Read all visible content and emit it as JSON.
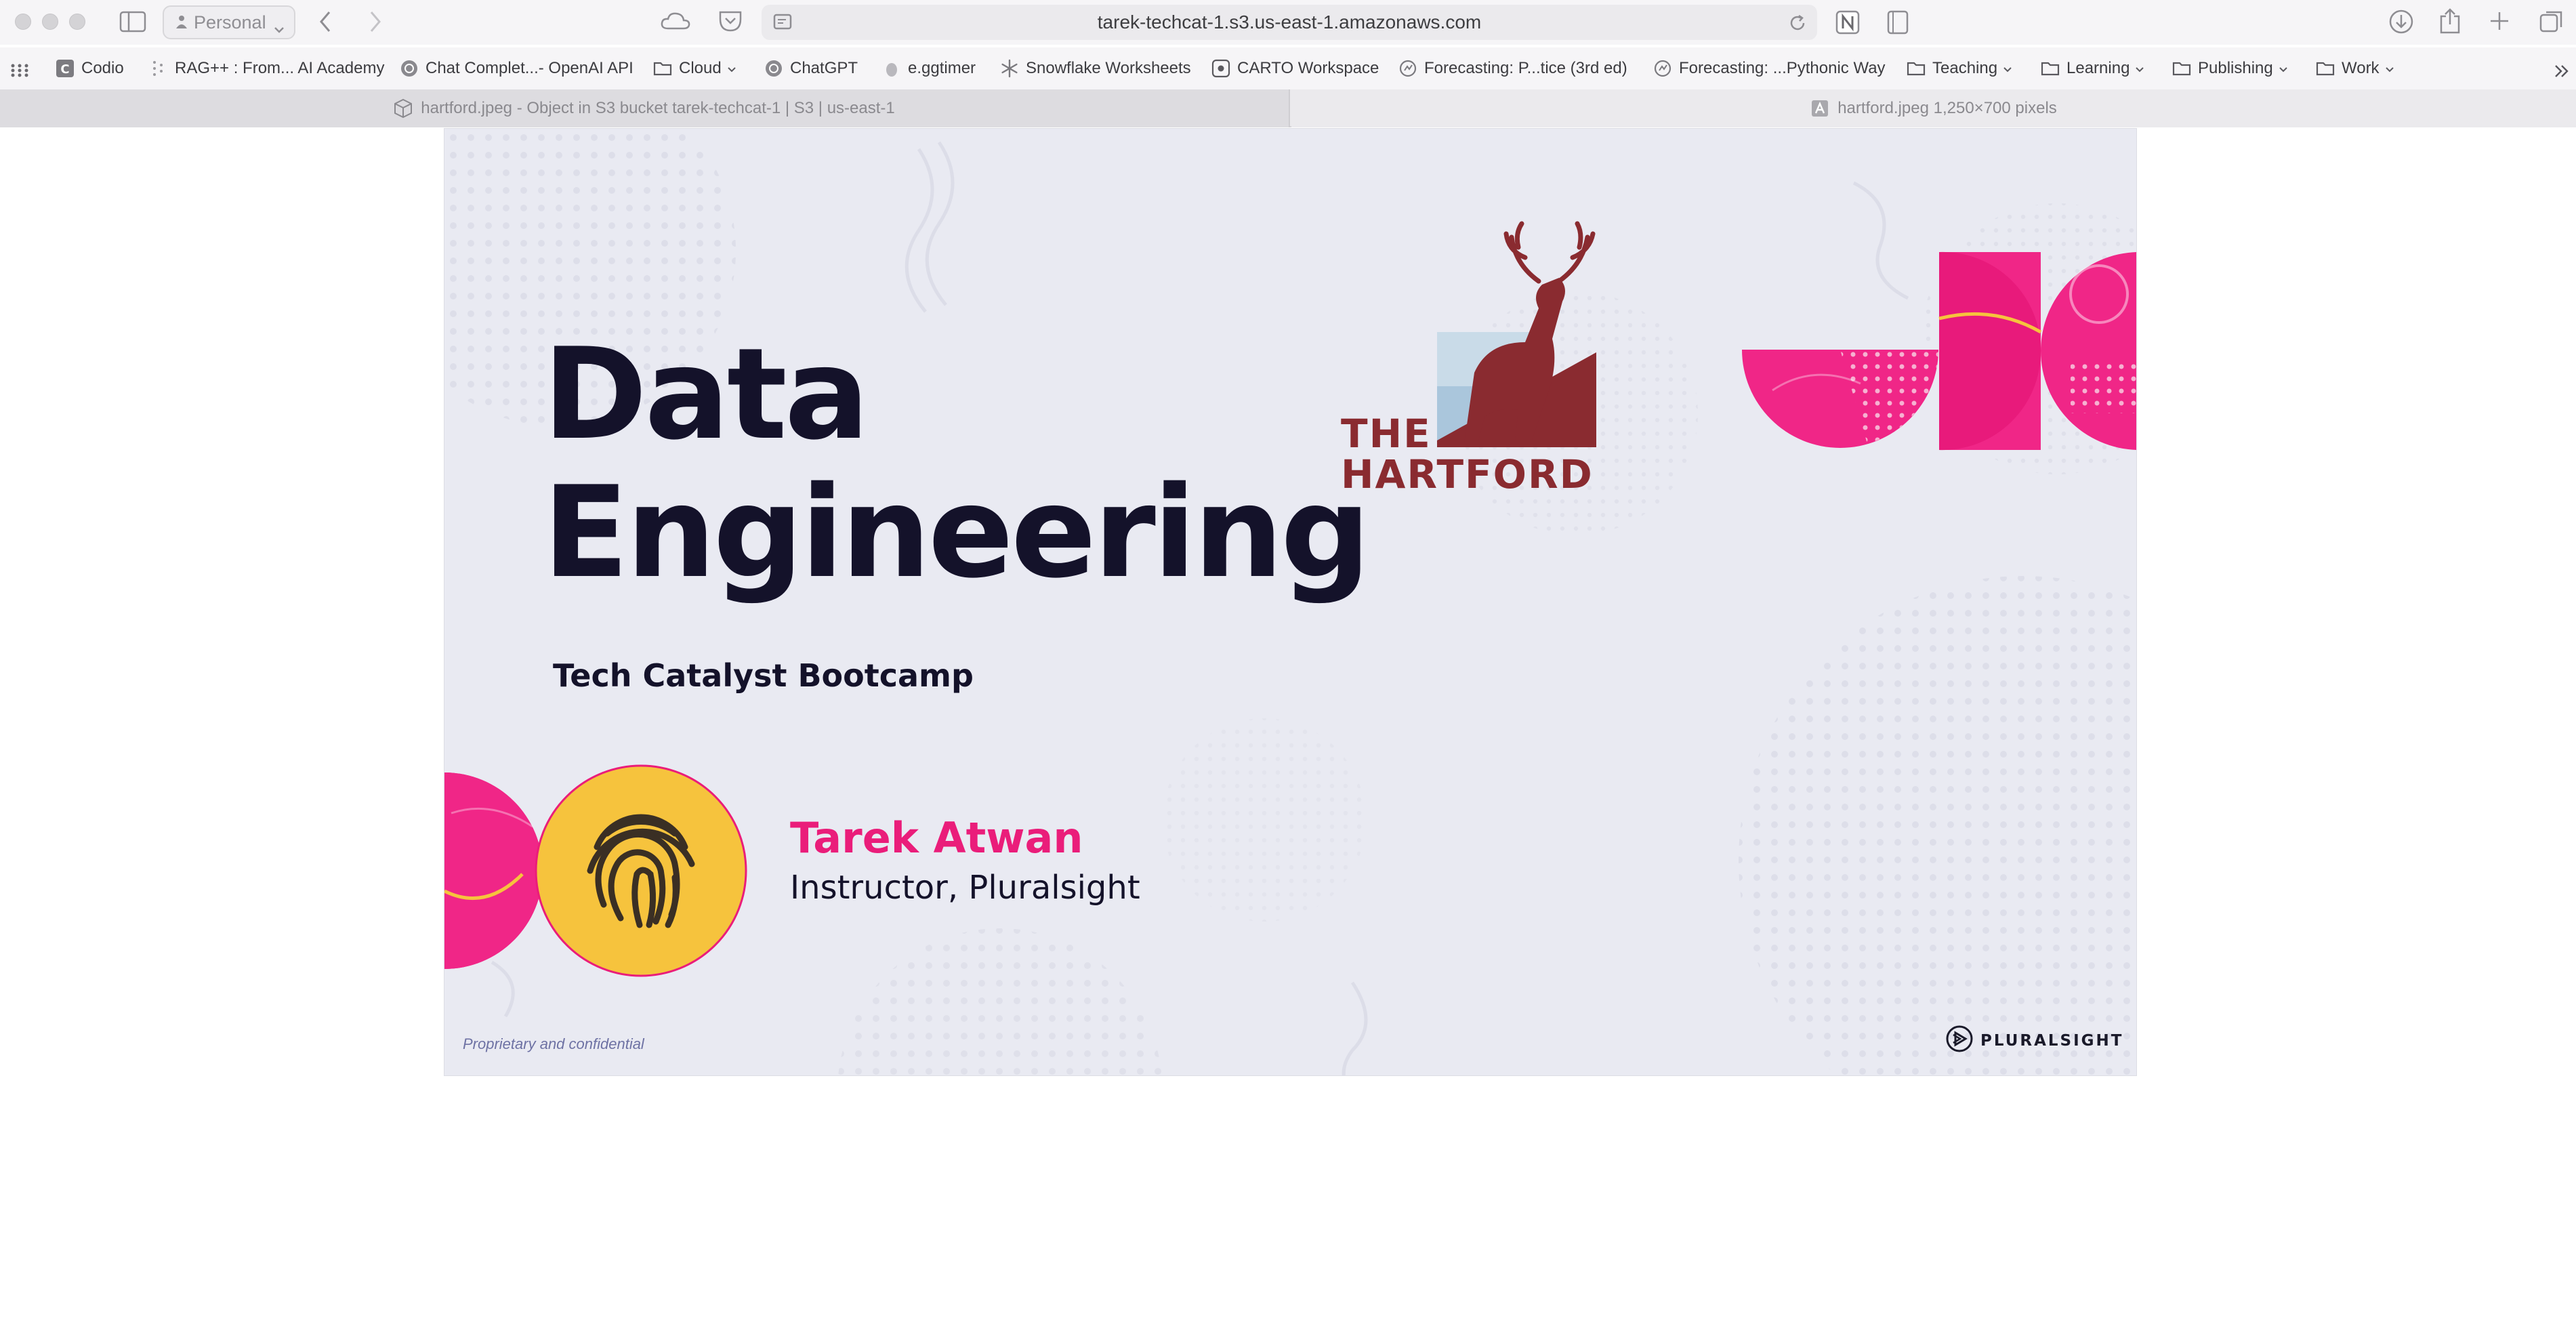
{
  "browser": {
    "profile_label": "Personal",
    "address": "tarek-techcat-1.s3.us-east-1.amazonaws.com"
  },
  "bookmarks": [
    {
      "label": "Codio",
      "icon": "codio-icon"
    },
    {
      "label": "RAG++ : From... AI Academy",
      "icon": "wandb-icon"
    },
    {
      "label": "Chat Complet...- OpenAI API",
      "icon": "openai-icon"
    },
    {
      "label": "Cloud",
      "icon": "folder-icon"
    },
    {
      "label": "ChatGPT",
      "icon": "openai-icon"
    },
    {
      "label": "e.ggtimer",
      "icon": "egg-icon"
    },
    {
      "label": "Snowflake Worksheets",
      "icon": "snowflake-icon"
    },
    {
      "label": "CARTO Workspace",
      "icon": "carto-icon"
    },
    {
      "label": "Forecasting: P...tice (3rd ed)",
      "icon": "book-icon"
    },
    {
      "label": "Forecasting: ...Pythonic Way",
      "icon": "book-icon"
    },
    {
      "label": "Teaching",
      "icon": "folder-icon"
    },
    {
      "label": "Learning",
      "icon": "folder-icon"
    },
    {
      "label": "Publishing",
      "icon": "folder-icon"
    },
    {
      "label": "Work",
      "icon": "folder-icon"
    }
  ],
  "tabs": [
    {
      "label": "hartford.jpeg - Object in S3 bucket tarek-techcat-1 | S3 | us-east-1",
      "active": false
    },
    {
      "label": "hartford.jpeg 1,250×700 pixels",
      "active": true
    }
  ],
  "slide": {
    "title_line1": "Data",
    "title_line2": "Engineering",
    "subtitle": "Tech Catalyst Bootcamp",
    "presenter_name": "Tarek Atwan",
    "presenter_role": "Instructor, Pluralsight",
    "footer_note": "Proprietary and confidential",
    "partner_logo_line1": "THE",
    "partner_logo_line2": "HARTFORD",
    "brand_logo": "PLURALSIGHT"
  },
  "colors": {
    "slide_background": "#e9eaf2",
    "title": "#14122a",
    "accent_pink": "#ea1d7a",
    "accent_yellow": "#f6c33d",
    "hartford_red": "#8a2b30"
  }
}
